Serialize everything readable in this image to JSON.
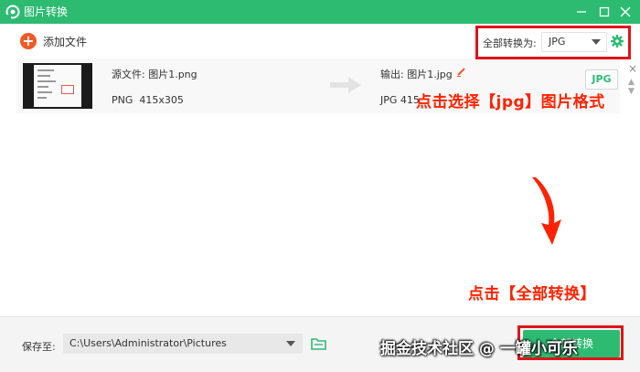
{
  "window": {
    "title": "图片转换"
  },
  "toolbar": {
    "add_file_label": "添加文件",
    "convert_all_to_label": "全部转换为:",
    "format_value": "JPG"
  },
  "file_row": {
    "source_name": "源文件: 图片1.png",
    "source_format": "PNG",
    "source_size": "415x305",
    "output_name": "输出: 图片1.jpg",
    "output_meta": "JPG  415",
    "output_badge": "JPG"
  },
  "annotations": {
    "select_jpg": "点击选择【jpg】图片格式",
    "click_convert": "点击【全部转换】"
  },
  "bottom": {
    "save_to_label": "保存至:",
    "save_path": "C:\\Users\\Administrator\\Pictures",
    "convert_all_button": "全部转换"
  },
  "watermark": "掘金技术社区 @ 一罐小可乐",
  "colors": {
    "accent": "#2dbb72",
    "add_button": "#f15a24",
    "annotation": "#ff2200",
    "highlight_box": "#e0141a"
  }
}
